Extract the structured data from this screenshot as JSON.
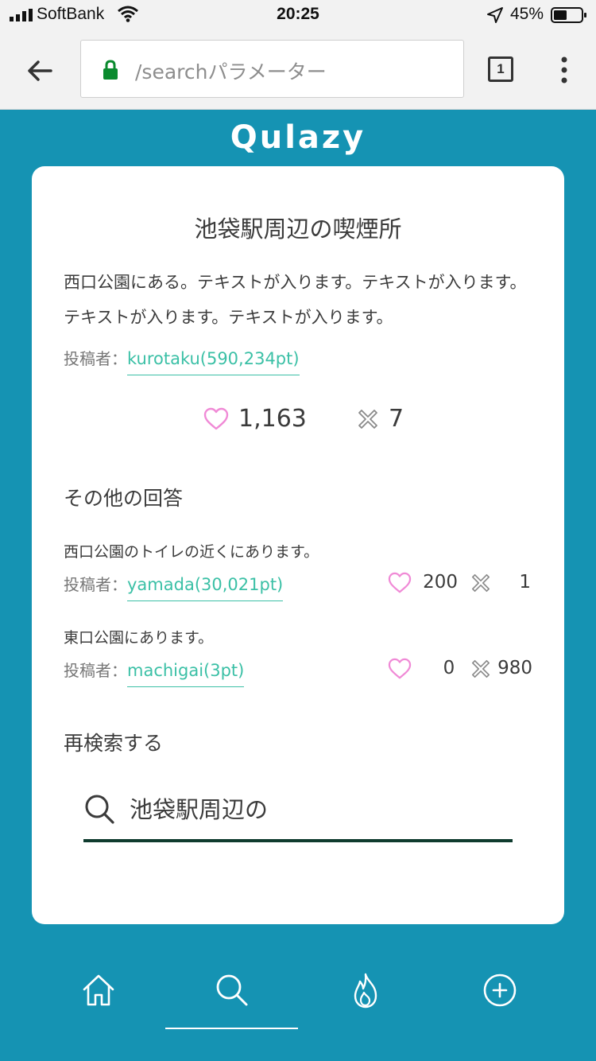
{
  "status_bar": {
    "carrier": "SoftBank",
    "time": "20:25",
    "battery": "45%"
  },
  "browser": {
    "url": "/searchパラメーター",
    "tab_count": "1"
  },
  "app": {
    "logo": "Qulazy"
  },
  "question": {
    "title": "池袋駅周辺の喫煙所",
    "answer_text": "西口公園にある。テキストが入ります。テキストが入ります。テキストが入ります。テキストが入ります。",
    "poster_label": "投稿者：",
    "poster": "kurotaku(590,234pt)",
    "likes": "1,163",
    "dislikes": "7"
  },
  "other_answers": {
    "title": "その他の回答",
    "items": [
      {
        "text": "西口公園のトイレの近くにあります。",
        "poster_label": "投稿者：",
        "poster": "yamada(30,021pt)",
        "likes": "200",
        "dislikes": "1"
      },
      {
        "text": "東口公園にあります。",
        "poster_label": "投稿者：",
        "poster": "machigai(3pt)",
        "likes": "0",
        "dislikes": "980"
      }
    ]
  },
  "research": {
    "title": "再検索する",
    "value": "池袋駅周辺の"
  },
  "colors": {
    "background": "#1593b3",
    "accent_link": "#3bc0a6",
    "heart": "#f08ad6",
    "search_underline": "#0f3b2e"
  },
  "nav": {
    "items": [
      "home-icon",
      "search-icon",
      "fire-icon",
      "plus-icon"
    ],
    "active": "search-icon"
  }
}
